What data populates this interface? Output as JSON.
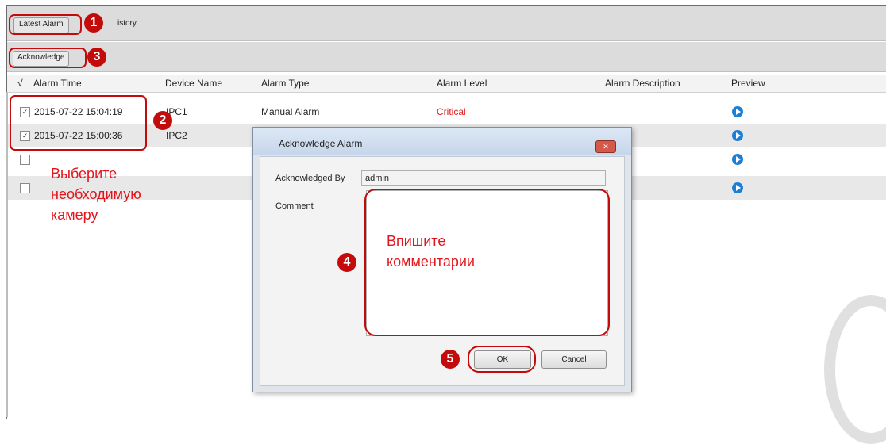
{
  "tabs": {
    "latest_label": "Latest Alarm",
    "history_label": "istory"
  },
  "toolbar": {
    "acknowledge_label": "Acknowledge"
  },
  "table": {
    "headers": {
      "check": "√",
      "alarm_time": "Alarm Time",
      "device_name": "Device Name",
      "alarm_type": "Alarm Type",
      "alarm_level": "Alarm Level",
      "alarm_description": "Alarm Description",
      "preview": "Preview"
    },
    "rows": [
      {
        "checked": "✓",
        "alarm_time": "2015-07-22 15:04:19",
        "device_name": "IPC1",
        "alarm_type": "Manual Alarm",
        "alarm_level": "Critical"
      },
      {
        "checked": "✓",
        "alarm_time": "2015-07-22 15:00:36",
        "device_name": "IPC2",
        "alarm_type": "",
        "alarm_level": ""
      },
      {
        "checked": "",
        "alarm_time": "",
        "device_name": "",
        "alarm_type": "",
        "alarm_level": ""
      },
      {
        "checked": "",
        "alarm_time": "",
        "device_name": "",
        "alarm_type": "",
        "alarm_level": ""
      }
    ],
    "critical_color": "#e02020",
    "play_icon": "play-circle-icon"
  },
  "annotations": {
    "badge_1": "1",
    "badge_2": "2",
    "badge_3": "3",
    "badge_4": "4",
    "badge_5": "5",
    "select_hint": [
      "Выберите",
      "необходимую",
      "камеру"
    ],
    "comment_hint": [
      "Впишите",
      "комментарии"
    ],
    "accent_color": "#c40b0b",
    "hint_color": "#e3141b"
  },
  "dialog": {
    "title": "Acknowledge Alarm",
    "close_icon": "close-icon",
    "acknowledged_by_label": "Acknowledged By",
    "acknowledged_by_value": "admin",
    "comment_label": "Comment",
    "ok_label": "OK",
    "cancel_label": "Cancel"
  }
}
